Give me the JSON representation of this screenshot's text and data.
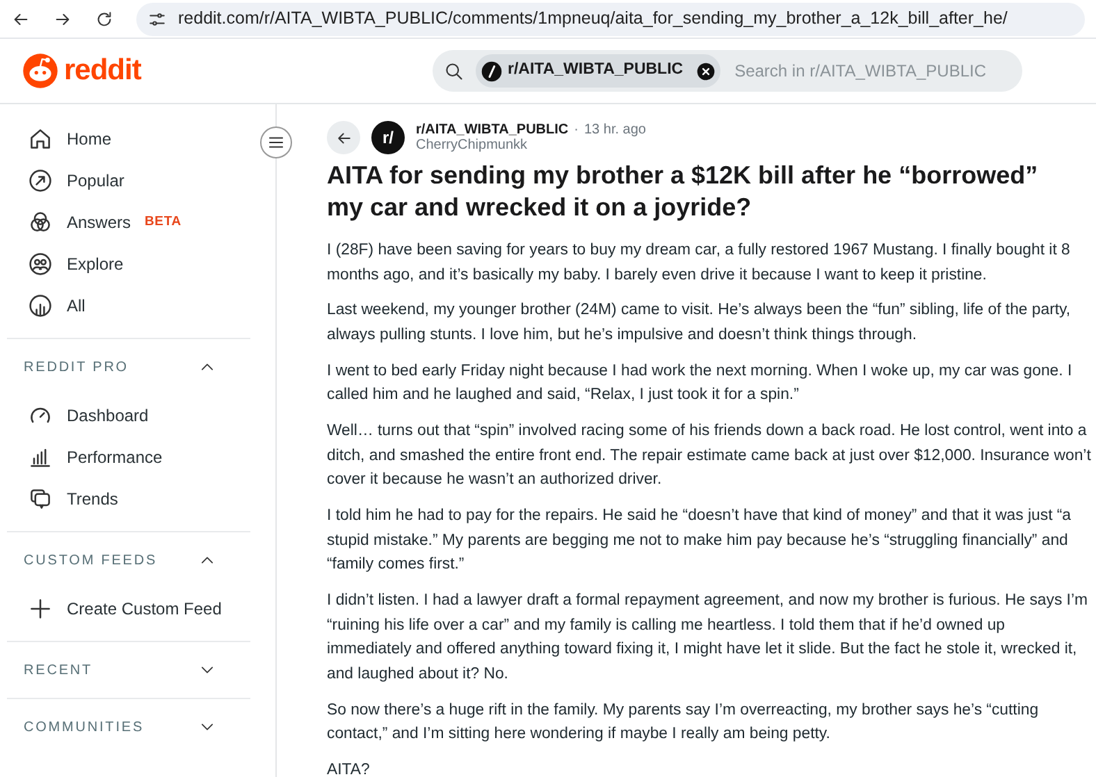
{
  "browser": {
    "url": "reddit.com/r/AITA_WIBTA_PUBLIC/comments/1mpneuq/aita_for_sending_my_brother_a_12k_bill_after_he/"
  },
  "header": {
    "logo": "reddit",
    "search_chip": "r/AITA_WIBTA_PUBLIC",
    "search": {
      "placeholder": "Search in r/AITA_WIBTA_PUBLIC"
    }
  },
  "sidebar": {
    "items": [
      {
        "label": "Home"
      },
      {
        "label": "Popular"
      },
      {
        "label": "Answers",
        "badge": "BETA"
      },
      {
        "label": "Explore"
      },
      {
        "label": "All"
      }
    ],
    "sections": [
      {
        "title": "REDDIT PRO",
        "expanded": true,
        "items": [
          {
            "label": "Dashboard"
          },
          {
            "label": "Performance"
          },
          {
            "label": "Trends"
          }
        ]
      },
      {
        "title": "CUSTOM FEEDS",
        "expanded": true,
        "items": [
          {
            "label": "Create Custom Feed"
          }
        ]
      },
      {
        "title": "RECENT",
        "expanded": false
      },
      {
        "title": "COMMUNITIES",
        "expanded": false
      }
    ]
  },
  "post": {
    "avatar": "r/",
    "community": "r/AITA_WIBTA_PUBLIC",
    "separator": "·",
    "time": "13 hr. ago",
    "author": "CherryChipmunkk",
    "title": "AITA for sending my brother a $12K bill after he “borrowed” my car and wrecked it on a joyride?",
    "paragraphs": [
      "I (28F) have been saving for years to buy my dream car, a fully restored 1967 Mustang. I finally bought it 8 months ago, and it’s basically my baby. I barely even drive it because I want to keep it pristine.",
      "Last weekend, my younger brother (24M) came to visit. He’s always been the “fun” sibling, life of the party, always pulling stunts. I love him, but he’s impulsive and doesn’t think things through.",
      "I went to bed early Friday night because I had work the next morning. When I woke up, my car was gone. I called him and he laughed and said, “Relax, I just took it for a spin.”",
      "Well… turns out that “spin” involved racing some of his friends down a back road. He lost control, went into a ditch, and smashed the entire front end. The repair estimate came back at just over $12,000. Insurance won’t cover it because he wasn’t an authorized driver.",
      "I told him he had to pay for the repairs. He said he “doesn’t have that kind of money” and that it was just “a stupid mistake.” My parents are begging me not to make him pay because he’s “struggling financially” and “family comes first.”",
      "I didn’t listen. I had a lawyer draft a formal repayment agreement, and now my brother is furious. He says I’m “ruining his life over a car” and my family is calling me heartless. I told them that if he’d owned up immediately and offered anything toward fixing it, I might have let it slide. But the fact he stole it, wrecked it, and laughed about it? No.",
      "So now there’s a huge rift in the family. My parents say I’m overreacting, my brother says he’s “cutting contact,” and I’m sitting here wondering if maybe I really am being petty.",
      "AITA?"
    ]
  }
}
